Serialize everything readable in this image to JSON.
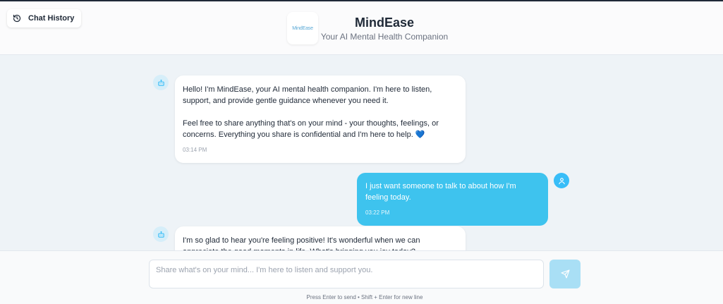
{
  "header": {
    "history_label": "Chat History",
    "logo_text": "MindEase",
    "title": "MindEase",
    "subtitle": "Your AI Mental Health Companion"
  },
  "messages": [
    {
      "role": "bot",
      "text": "Hello! I'm MindEase, your AI mental health companion. I'm here to listen, support, and provide gentle guidance whenever you need it.\n\nFeel free to share anything that's on your mind - your thoughts, feelings, or concerns. Everything you share is confidential and I'm here to help. 💙",
      "time": "03:14 PM"
    },
    {
      "role": "user",
      "text": "I just want someone to talk to about how I'm feeling today.",
      "time": "03:22 PM"
    },
    {
      "role": "bot",
      "text": "I'm so glad to hear you're feeling positive! It's wonderful when we can appreciate the good moments in life. What's bringing you joy today?",
      "time": ""
    }
  ],
  "composer": {
    "placeholder": "Share what's on your mind... I'm here to listen and support you.",
    "hint": "Press Enter to send • Shift + Enter for new line"
  },
  "colors": {
    "accent": "#3ec3ee",
    "send_disabled": "#a9dff5",
    "background": "#eef3f7"
  },
  "icons": {
    "history": "history-icon",
    "bot": "bot-icon",
    "user": "user-icon",
    "send": "send-icon"
  }
}
